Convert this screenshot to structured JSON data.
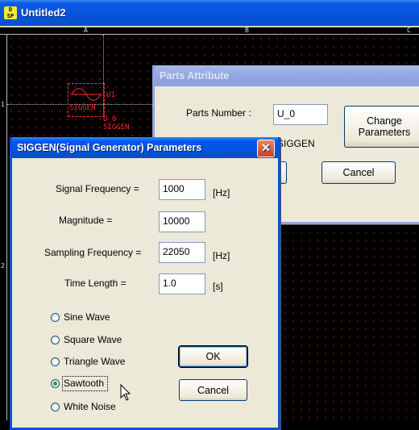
{
  "app": {
    "title": "Untitled2",
    "icon": "dsp-app-icon",
    "icon_text": "D SP"
  },
  "rulers": {
    "columns": [
      "A",
      "B",
      "C"
    ],
    "rows": [
      "1",
      "2"
    ]
  },
  "schematic": {
    "part_ref_top": "U1",
    "part_name_box": "SIGGEN",
    "part_ref": "U_0",
    "part_name": "SIGGEN"
  },
  "parts_dialog": {
    "title": "Parts Attribute",
    "parts_number_label": "Parts Number :",
    "parts_number_value": "U_0",
    "part_type": "SIGGEN",
    "change_button": "Change\nParameters",
    "cancel_button": "Cancel"
  },
  "siggen_dialog": {
    "title": "SIGGEN(Signal Generator) Parameters",
    "signal_frequency_label": "Signal Frequency =",
    "signal_frequency_value": "1000",
    "signal_frequency_unit": "[Hz]",
    "magnitude_label": "Magnitude =",
    "magnitude_value": "10000",
    "sampling_frequency_label": "Sampling Frequency =",
    "sampling_frequency_value": "22050",
    "sampling_frequency_unit": "[Hz]",
    "time_length_label": "Time Length =",
    "time_length_value": "1.0",
    "time_length_unit": "[s]",
    "waveforms": [
      {
        "label": "Sine Wave",
        "checked": false
      },
      {
        "label": "Square Wave",
        "checked": false
      },
      {
        "label": "Triangle Wave",
        "checked": false
      },
      {
        "label": "Sawtooth",
        "checked": true
      },
      {
        "label": "White Noise",
        "checked": false
      }
    ],
    "ok_button": "OK",
    "cancel_button": "Cancel"
  },
  "colors": {
    "canvas_bg": "#000000",
    "grid_dot": "#6a0f0f",
    "part_red": "#ff2a2a",
    "dialog_bg": "#ece9d8",
    "active_title": "#0452d8",
    "inactive_title": "#92a6e2"
  }
}
